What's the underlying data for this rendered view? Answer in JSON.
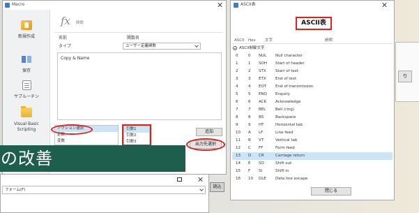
{
  "colors": {
    "banner": "#1e5e4d",
    "annotation": "#e0201b",
    "selection": "#cde4f6"
  },
  "macro_window": {
    "title": "Macro",
    "sidebar": [
      {
        "icon": "new-file-icon",
        "label": "新規作成"
      },
      {
        "icon": "save-icon",
        "label": "保存"
      },
      {
        "icon": "script-icon",
        "label": "サブルーチン"
      },
      {
        "icon": "folder-icon",
        "label": "Visual Basic Scripting"
      }
    ],
    "header": {
      "icon_text": "fx",
      "caption": "関数"
    },
    "fields": {
      "name_label": "名前",
      "name_value": "関数名",
      "type_label": "タイプ",
      "type_value": "ユーザー定義関数"
    },
    "editor_text": "Copy & Name",
    "action_list": [
      "アクション選択",
      "定数",
      "変数"
    ],
    "argument_list": [
      "引数1",
      "引数2",
      "引数3"
    ],
    "add_button": "追加",
    "output_button": "出力先選択"
  },
  "banner": {
    "text": "の改善"
  },
  "form_window": {
    "field_text": "フォーム(F)",
    "side_button": "読込"
  },
  "ascii_window": {
    "title": "ASCII表",
    "heading": "ASCII表",
    "columns": {
      "dec": "ASCII",
      "hex": "Hex",
      "char": "文字",
      "desc": "説明"
    },
    "group": "ASCII制御文字",
    "rows": [
      {
        "dec": "0",
        "hex": "0",
        "code": "NUL",
        "desc": "Null character"
      },
      {
        "dec": "1",
        "hex": "1",
        "code": "SOH",
        "desc": "Start of header"
      },
      {
        "dec": "2",
        "hex": "2",
        "code": "STX",
        "desc": "Start of text"
      },
      {
        "dec": "3",
        "hex": "3",
        "code": "ETX",
        "desc": "End of text"
      },
      {
        "dec": "4",
        "hex": "4",
        "code": "EOT",
        "desc": "End of transmission"
      },
      {
        "dec": "5",
        "hex": "5",
        "code": "ENQ",
        "desc": "Enquiry"
      },
      {
        "dec": "6",
        "hex": "6",
        "code": "ACK",
        "desc": "Acknowledge"
      },
      {
        "dec": "7",
        "hex": "7",
        "code": "BEL",
        "desc": "Bell (ring)"
      },
      {
        "dec": "8",
        "hex": "8",
        "code": "BS",
        "desc": "Backspace"
      },
      {
        "dec": "9",
        "hex": "9",
        "code": "HT",
        "desc": "Horizontal tab"
      },
      {
        "dec": "10",
        "hex": "A",
        "code": "LF",
        "desc": "Line feed"
      },
      {
        "dec": "11",
        "hex": "B",
        "code": "VT",
        "desc": "Vertical tab"
      },
      {
        "dec": "12",
        "hex": "C",
        "code": "FF",
        "desc": "Form feed"
      },
      {
        "dec": "13",
        "hex": "D",
        "code": "CR",
        "desc": "Carriage return",
        "selected": true
      },
      {
        "dec": "14",
        "hex": "E",
        "code": "SO",
        "desc": "Shift out"
      },
      {
        "dec": "15",
        "hex": "F",
        "code": "SI",
        "desc": "Shift in"
      },
      {
        "dec": "16",
        "hex": "10",
        "code": "DLE",
        "desc": "Data line escape"
      }
    ],
    "close_button": "閉じる"
  },
  "side_panel": {
    "button": "り"
  }
}
